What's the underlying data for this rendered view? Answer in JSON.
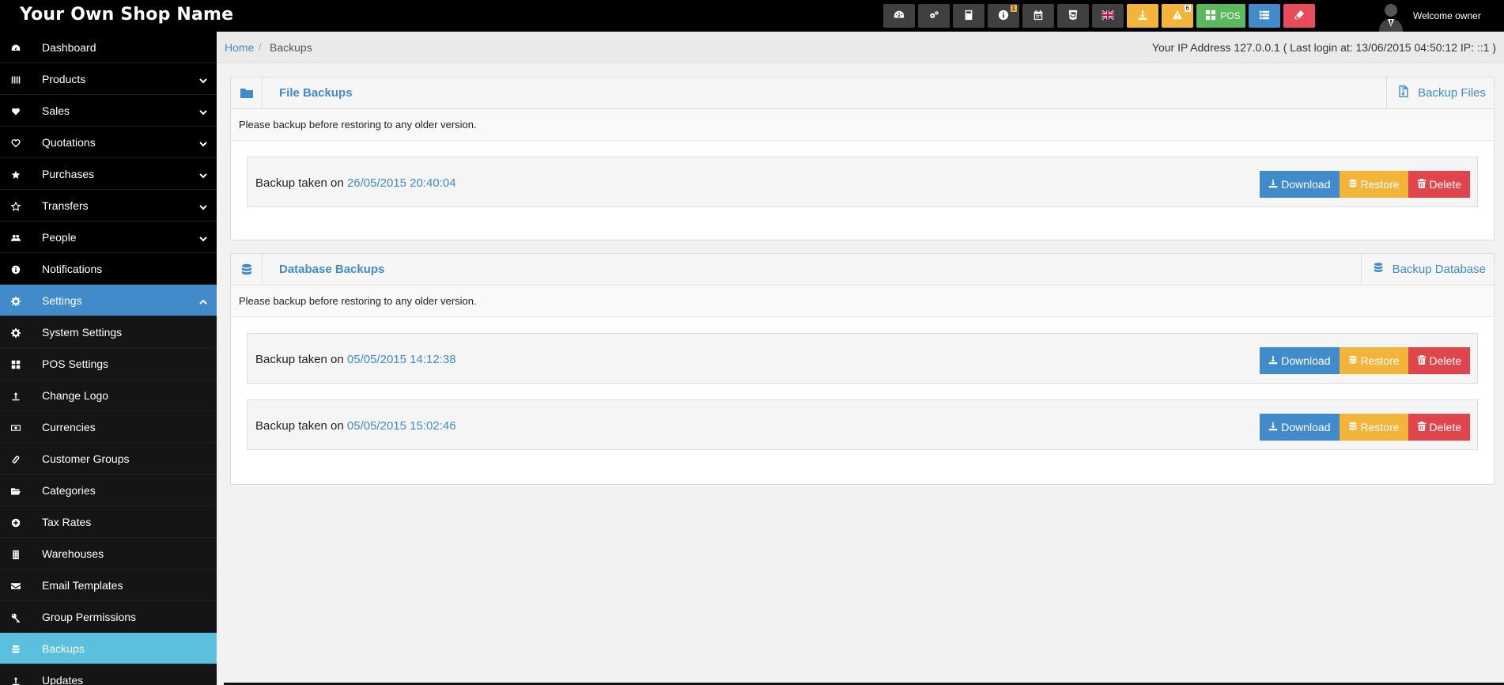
{
  "app": {
    "brand": "Your Own Shop Name",
    "welcome": "Welcome owner"
  },
  "topbar": {
    "buttons": [
      {
        "icon": "dashboard-icon"
      },
      {
        "icon": "cogs-icon"
      },
      {
        "icon": "calculator-icon"
      },
      {
        "icon": "info-icon",
        "badge": "1"
      },
      {
        "icon": "calendar-icon"
      },
      {
        "icon": "html5-icon"
      },
      {
        "icon": "uk-flag-icon"
      },
      {
        "icon": "download-icon",
        "color": "#f3b43a"
      },
      {
        "icon": "warning-icon",
        "badge": "6",
        "color": "#f3b43a"
      },
      {
        "icon": "pos-grid-icon",
        "label": "POS",
        "color": "#5cb85c"
      },
      {
        "icon": "list-icon",
        "color": "#428bca"
      },
      {
        "icon": "eraser-icon",
        "color": "#e84b59"
      }
    ]
  },
  "sidebar": {
    "items": [
      {
        "label": "Dashboard",
        "icon": "dashboard-icon"
      },
      {
        "label": "Products",
        "icon": "barcode-icon",
        "expandable": true
      },
      {
        "label": "Sales",
        "icon": "heart-icon",
        "expandable": true
      },
      {
        "label": "Quotations",
        "icon": "heart-outline-icon",
        "expandable": true
      },
      {
        "label": "Purchases",
        "icon": "star-icon",
        "expandable": true
      },
      {
        "label": "Transfers",
        "icon": "star-outline-icon",
        "expandable": true
      },
      {
        "label": "People",
        "icon": "users-icon",
        "expandable": true
      },
      {
        "label": "Notifications",
        "icon": "info-icon"
      },
      {
        "label": "Settings",
        "icon": "gear-icon",
        "expanded": true
      },
      {
        "label": "System Settings",
        "icon": "gear-icon",
        "sub": true
      },
      {
        "label": "POS Settings",
        "icon": "th-large-icon",
        "sub": true
      },
      {
        "label": "Change Logo",
        "icon": "upload-icon",
        "sub": true
      },
      {
        "label": "Currencies",
        "icon": "money-icon",
        "sub": true
      },
      {
        "label": "Customer Groups",
        "icon": "chain-icon",
        "sub": true
      },
      {
        "label": "Categories",
        "icon": "folder-open-icon",
        "sub": true
      },
      {
        "label": "Tax Rates",
        "icon": "plus-circle-icon",
        "sub": true
      },
      {
        "label": "Warehouses",
        "icon": "building-icon",
        "sub": true
      },
      {
        "label": "Email Templates",
        "icon": "envelope-icon",
        "sub": true
      },
      {
        "label": "Group Permissions",
        "icon": "key-icon",
        "sub": true
      },
      {
        "label": "Backups",
        "icon": "database-icon",
        "sub": true,
        "active": true
      },
      {
        "label": "Updates",
        "icon": "upload-icon",
        "sub": true
      }
    ]
  },
  "breadcrumb": {
    "home": "Home",
    "separator": "/",
    "current": "Backups"
  },
  "ip_info": "Your IP Address 127.0.0.1 ( Last login at: 13/06/2015 04:50:12 IP: ::1 )",
  "file_backups": {
    "title": "File Backups",
    "action": "Backup Files",
    "intro": "Please backup before restoring to any older version.",
    "rows": [
      {
        "label": "Backup taken on",
        "date": "26/05/2015 20:40:04"
      }
    ]
  },
  "db_backups": {
    "title": "Database Backups",
    "action": "Backup Database",
    "intro": "Please backup before restoring to any older version.",
    "rows": [
      {
        "label": "Backup taken on",
        "date": "05/05/2015 14:12:38"
      },
      {
        "label": "Backup taken on",
        "date": "05/05/2015 15:02:46"
      }
    ]
  },
  "actions": {
    "download": "Download",
    "restore": "Restore",
    "delete": "Delete"
  },
  "colors": {
    "primary": "#428bca",
    "warning": "#f3b43a",
    "danger": "#e0454b",
    "success": "#5cb85c",
    "info": "#5bc0de"
  }
}
